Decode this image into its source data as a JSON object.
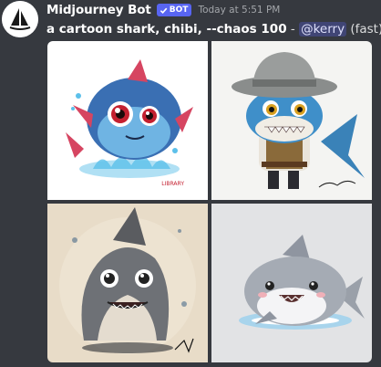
{
  "message": {
    "username": "Midjourney Bot",
    "badge": "BOT",
    "timestamp": "Today at 5:51 PM",
    "prompt": "a cartoon shark, chibi, --chaos 100",
    "separator": "-",
    "mention": "@kerry",
    "speed": "(fast)"
  },
  "images": [
    {
      "name": "shark-image-1",
      "signature": "LIBRARY"
    },
    {
      "name": "shark-image-2"
    },
    {
      "name": "shark-image-3"
    },
    {
      "name": "shark-image-4"
    }
  ],
  "colors": {
    "background": "#36393f",
    "badge": "#5865f2",
    "mention_bg": "#4e5ca8"
  }
}
